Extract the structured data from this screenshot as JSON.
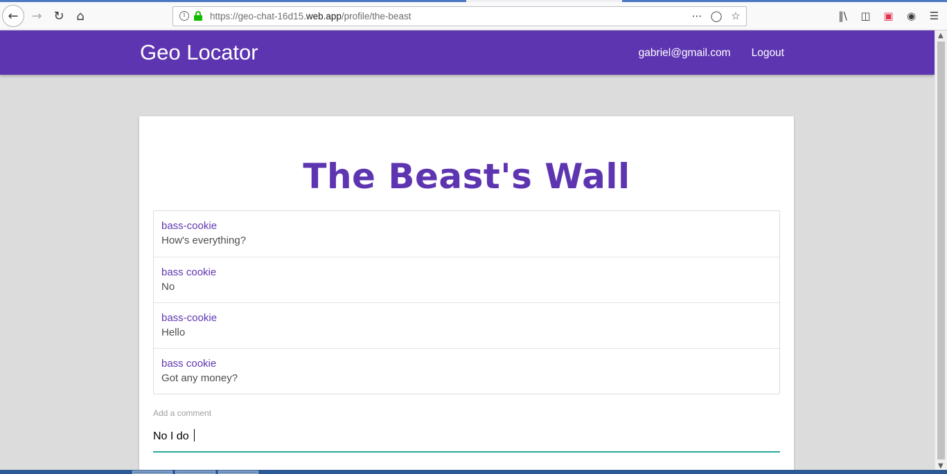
{
  "browser": {
    "url_prefix": "https://geo-chat-16d15.",
    "url_host": "web.app",
    "url_path": "/profile/the-beast",
    "icons": [
      "back-icon",
      "forward-icon",
      "reload-icon",
      "home-icon",
      "info-icon",
      "lock-icon",
      "more-icon",
      "pocket-icon",
      "bookmark-star-icon",
      "library-icon",
      "sidebar-icon",
      "pocket-extension-icon",
      "account-icon",
      "menu-icon"
    ]
  },
  "header": {
    "brand": "Geo Locator",
    "email": "gabriel@gmail.com",
    "logout": "Logout",
    "color": "#5e35b1"
  },
  "wall": {
    "title": "The Beast's Wall",
    "comments": [
      {
        "author": "bass-cookie",
        "text": "How's everything?"
      },
      {
        "author": "bass cookie",
        "text": "No"
      },
      {
        "author": "bass-cookie",
        "text": "Hello"
      },
      {
        "author": "bass cookie",
        "text": "Got any money?"
      }
    ],
    "input_label": "Add a comment",
    "input_value": "No I do ",
    "accent": "#26a69a"
  }
}
